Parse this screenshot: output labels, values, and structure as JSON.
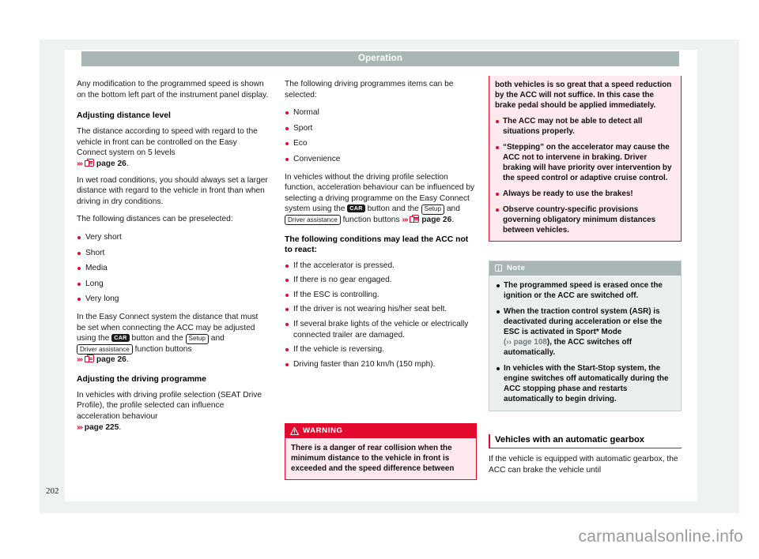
{
  "header": {
    "title": "Operation"
  },
  "folio": {
    "page_number": "202"
  },
  "watermark": {
    "text": "carmanualsonline.info"
  },
  "icons": {
    "page_ref": "page-reference-icon",
    "warning_triangle": "warning-triangle-icon",
    "note_info": "info-icon"
  },
  "keys": {
    "car": "CAR",
    "setup": "Setup",
    "driver_assistance": "Driver assistance"
  },
  "column_1": {
    "intro": "Any modification to the programmed speed is shown on the bottom left part of the instrument panel display.",
    "heading_distance": "Adjusting distance level",
    "distance_p1_a": "The distance according to speed with regard to the vehicle in front can be controlled on the Easy Connect system on 5 levels",
    "distance_p1_ref_arrow": "›››",
    "distance_p1_ref_text": "page 26",
    "distance_p1_end": ".",
    "distance_p2": "In wet road conditions, you should always set a larger distance with regard to the vehicle in front than when driving in dry conditions.",
    "distance_p3": "The following distances can be preselected:",
    "distance_options": [
      "Very short",
      "Short",
      "Media",
      "Long",
      "Very long"
    ],
    "distance_p4_a": "In the Easy Connect system the distance that must be set when connecting the ACC may be adjusted using the",
    "distance_p4_b": "button and the",
    "distance_p4_c": "and",
    "distance_p4_d": "function buttons",
    "distance_p4_ref_arrow": "›››",
    "distance_p4_ref_text": "page 26",
    "distance_p4_end": ".",
    "heading_programme": "Adjusting the driving programme",
    "programme_p1": "In vehicles with driving profile selection (SEAT Drive Profile), the profile selected can influence acceleration behaviour",
    "programme_ref_arrow": "›››",
    "programme_ref_text": "page 225",
    "programme_ref_end": "."
  },
  "column_2": {
    "intro": "The following driving programmes items can be selected:",
    "programme_options": [
      "Normal",
      "Sport",
      "Eco",
      "Convenience"
    ],
    "no_profile_a": "In vehicles without the driving profile selection function, acceleration behaviour can be influenced by selecting a driving programme on the Easy Connect system using the",
    "no_profile_b": "button and the",
    "no_profile_c": "and",
    "no_profile_d": "function buttons",
    "no_profile_ref_arrow": "›››",
    "no_profile_ref_text": "page 26",
    "no_profile_end": ".",
    "conditions_heading": "The following conditions may lead the ACC not to react:",
    "conditions": [
      "If the accelerator is pressed.",
      "If there is no gear engaged.",
      "If the ESC is controlling.",
      "If the driver is not wearing his/her seat belt.",
      "If several brake lights of the vehicle or electrically connected trailer are damaged.",
      "If the vehicle is reversing.",
      "Driving faster than 210 km/h (150 mph)."
    ],
    "warning": {
      "title": "WARNING",
      "text": "There is a danger of rear collision when the minimum distance to the vehicle in front is exceeded and the speed difference between"
    }
  },
  "column_3": {
    "warning_continued": {
      "intro": "both vehicles is so great that a speed reduction by the ACC will not suffice. In this case the brake pedal should be applied immediately.",
      "bullets": [
        "The ACC may not be able to detect all situations properly.",
        "“Stepping” on the accelerator may cause the ACC not to intervene in braking. Driver braking will have priority over intervention by the speed control or adaptive cruise control.",
        "Always be ready to use the brakes!",
        "Observe country-specific provisions governing obligatory minimum distances between vehicles."
      ]
    },
    "note": {
      "title": "Note",
      "bullet_1": "The programmed speed is erased once the ignition or the ACC are switched off.",
      "bullet_2_a": "When the traction control system (ASR) is deactivated during acceleration or else the ESC is activated in Sport* Mode",
      "bullet_2_ref_open": "(",
      "bullet_2_ref_arrow": "››",
      "bullet_2_ref_text": "page 108",
      "bullet_2_b": "), the ACC switches off automatically.",
      "bullet_3": "In vehicles with the Start-Stop system, the engine switches off automatically during the ACC stopping phase and restarts automatically to begin driving."
    },
    "section": {
      "heading": "Vehicles with an automatic gearbox",
      "body": "If the vehicle is equipped with automatic gearbox, the ACC can brake the vehicle until"
    }
  },
  "colors": {
    "accent_red": "#e3092c",
    "header_grey": "#a9b6b6",
    "warning_bg": "#fde9ee",
    "note_bg": "#eceff0",
    "mat": "#eef2f2"
  }
}
